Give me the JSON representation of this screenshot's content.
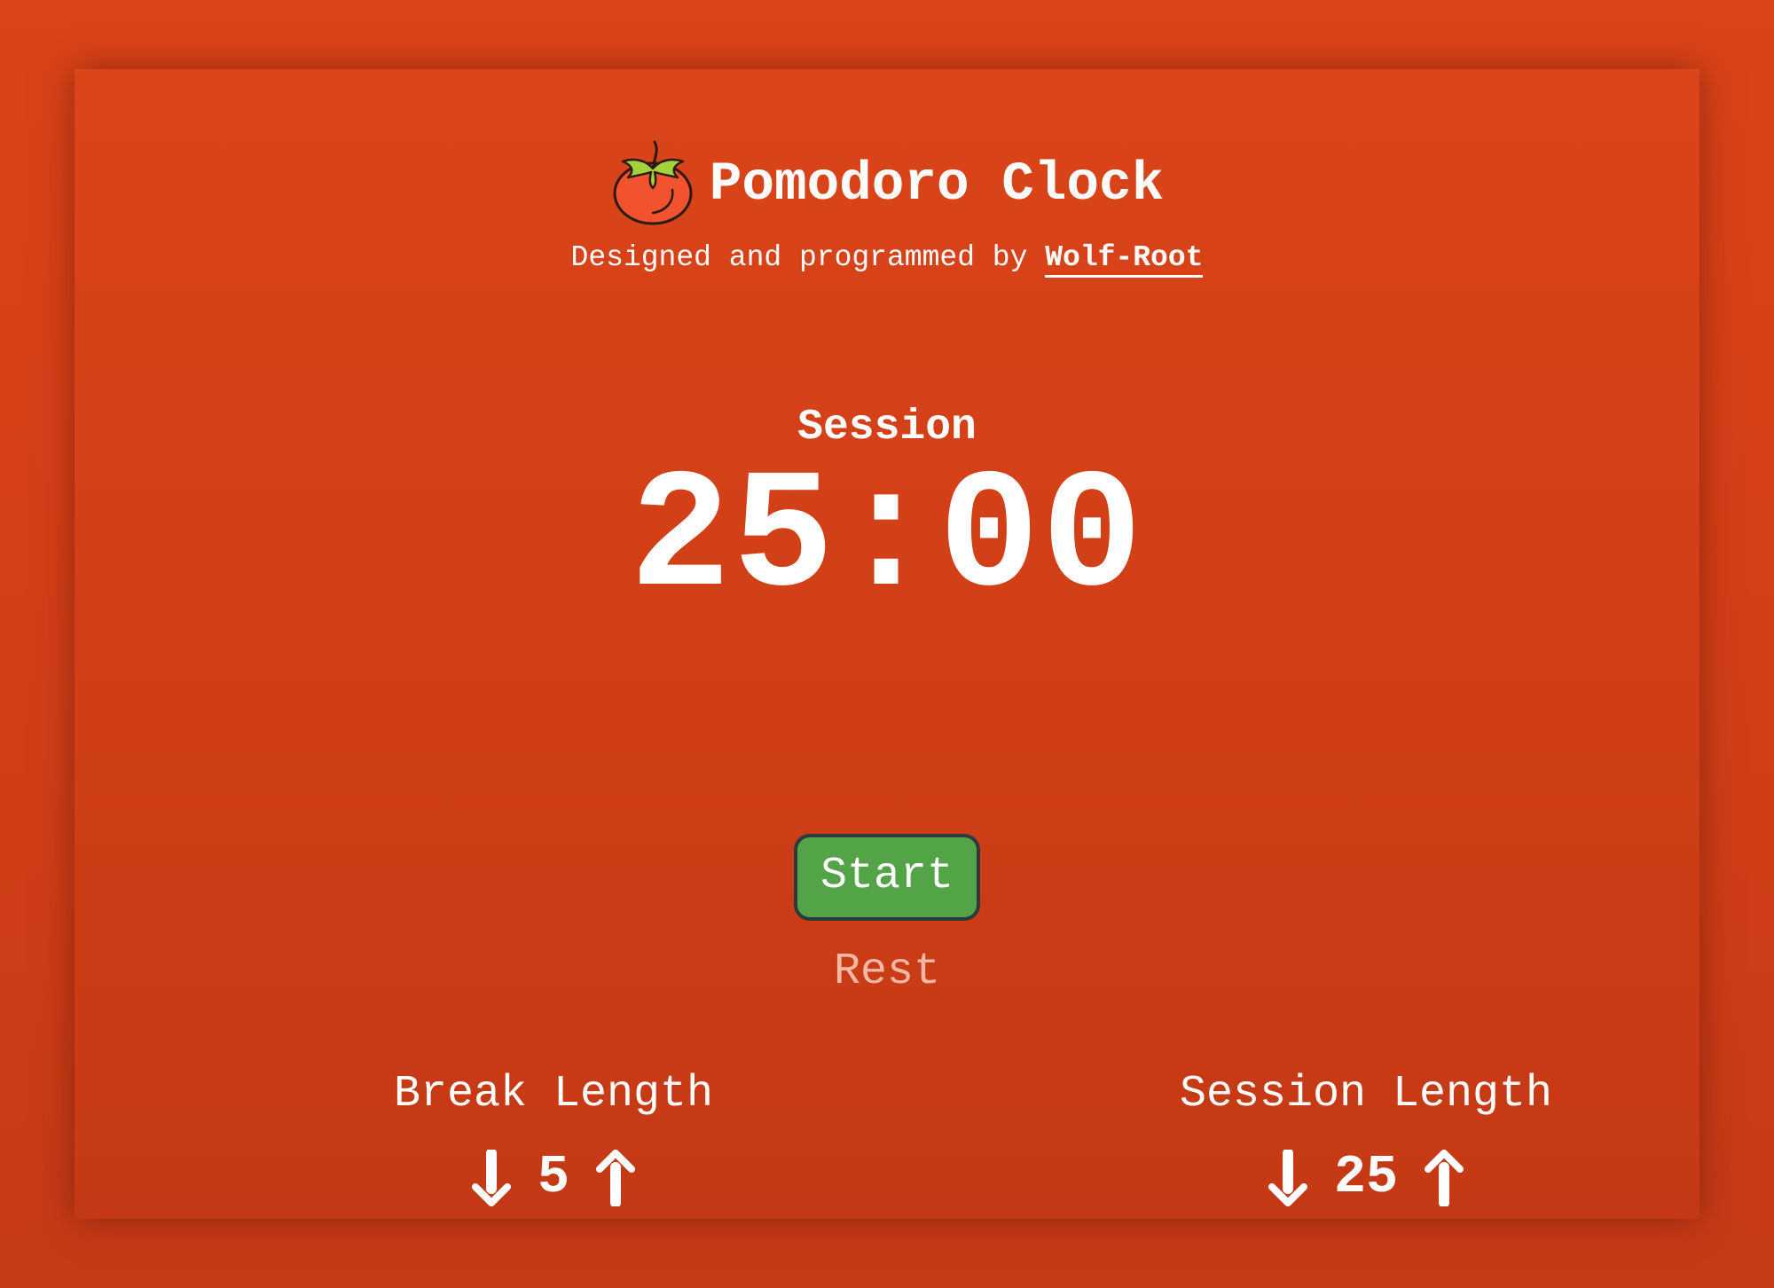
{
  "header": {
    "title": "Pomodoro Clock",
    "subtitle_prefix": "Designed and programmed by ",
    "author_link": "Wolf-Root",
    "icon": "tomato-icon"
  },
  "timer": {
    "label": "Session",
    "time": "25:00"
  },
  "controls": {
    "start_label": "Start",
    "rest_label": "Rest"
  },
  "break_length": {
    "label": "Break Length",
    "value": "5",
    "decrement_icon": "arrow-down-icon",
    "increment_icon": "arrow-up-icon"
  },
  "session_length": {
    "label": "Session Length",
    "value": "25",
    "decrement_icon": "arrow-down-icon",
    "increment_icon": "arrow-up-icon"
  },
  "colors": {
    "background": "#d84218",
    "card": "#d13f17",
    "start_button": "#52a447",
    "start_border": "#2f3a3a",
    "rest_text": "#f1b8a4",
    "text": "#ffffff"
  }
}
